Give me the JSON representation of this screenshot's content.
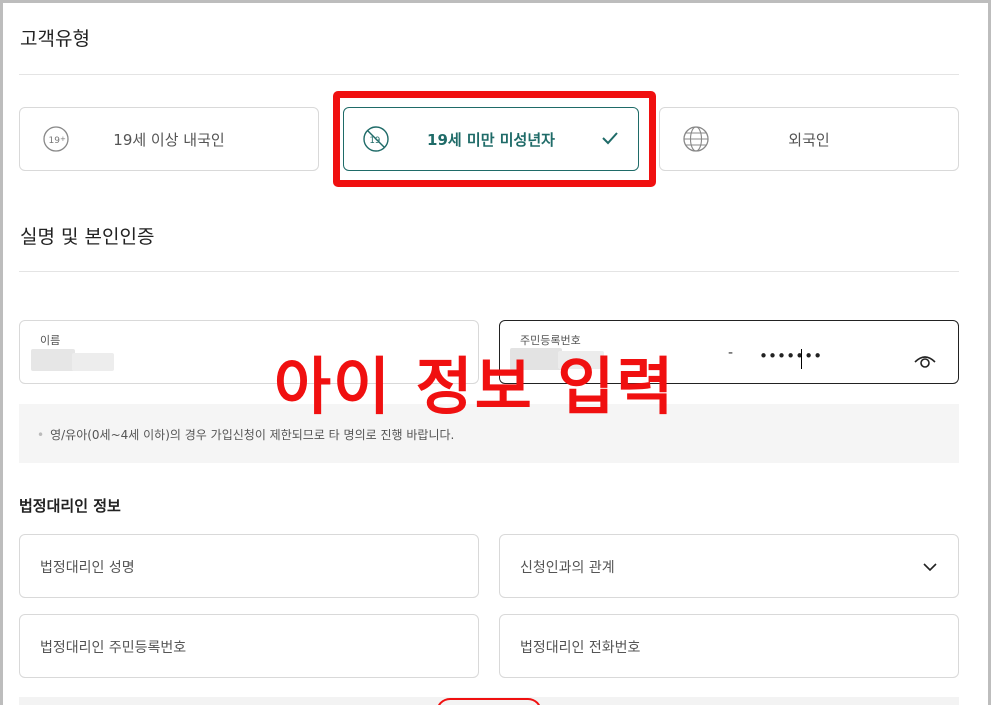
{
  "customer_type": {
    "title": "고객유형",
    "options": [
      {
        "label": "19세 이상 내국인",
        "icon": "age-19-plus-icon",
        "selected": false
      },
      {
        "label": "19세 미만 미성년자",
        "icon": "age-under-19-icon",
        "selected": true
      },
      {
        "label": "외국인",
        "icon": "globe-icon",
        "selected": false
      }
    ]
  },
  "verification": {
    "title": "실명 및 본인인증",
    "name_label": "이름",
    "rrn_label": "주민등록번호",
    "rrn_dash": "-",
    "rrn_masked": "•••••••"
  },
  "notice": {
    "text": "영/유아(0세~4세 이하)의 경우 가입신청이 제한되므로 타 명의로 진행 바랍니다."
  },
  "guardian": {
    "title": "법정대리인 정보",
    "name_placeholder": "법정대리인 성명",
    "relation_placeholder": "신청인과의 관계",
    "rrn_placeholder": "법정대리인 주민등록번호",
    "phone_placeholder": "법정대리인 전화번호"
  },
  "annotation": {
    "text": "아이 정보 입력",
    "color": "#f01010"
  },
  "colors": {
    "accent": "#1f6b68",
    "border": "#d9d9d9",
    "highlight": "#f01010"
  }
}
